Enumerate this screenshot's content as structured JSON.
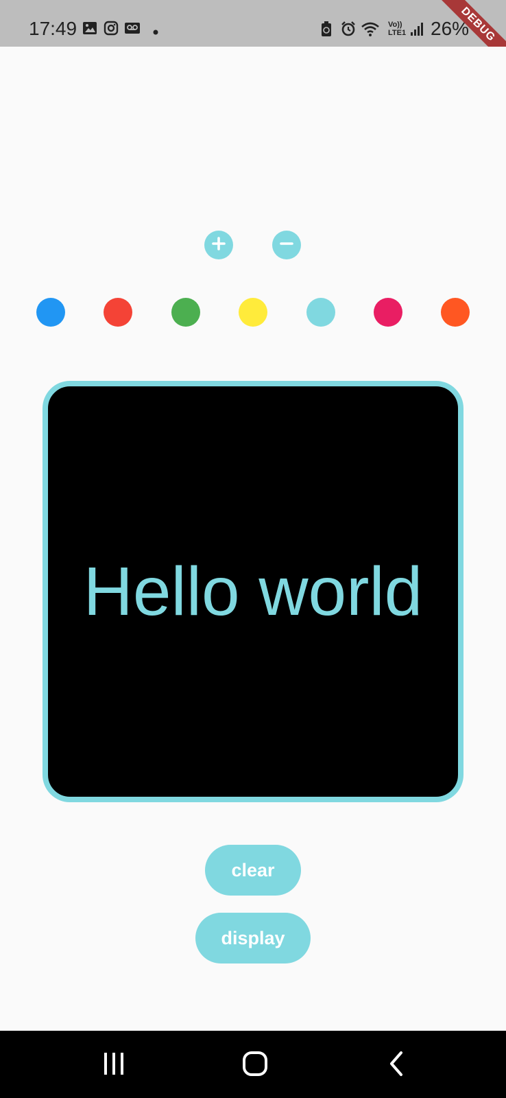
{
  "status_bar": {
    "time": "17:49",
    "icons_left": [
      "gallery-icon",
      "instagram-icon",
      "voicemail-icon",
      "dot-icon"
    ],
    "icons_right": [
      "battery-saver-icon",
      "alarm-icon",
      "wifi-icon",
      "volte-icon",
      "signal-icon"
    ],
    "volte_label": "Vo)) LTE1",
    "battery": "26%",
    "debug_banner": "DEBUG"
  },
  "size_controls": {
    "increase_icon": "plus-icon",
    "decrease_icon": "minus-icon"
  },
  "color_palette": [
    {
      "name": "blue",
      "color": "#2196f3"
    },
    {
      "name": "red",
      "color": "#f44336"
    },
    {
      "name": "green",
      "color": "#4caf50"
    },
    {
      "name": "yellow",
      "color": "#ffeb3b"
    },
    {
      "name": "cyan",
      "color": "#80d8e0"
    },
    {
      "name": "pink",
      "color": "#e91e63"
    },
    {
      "name": "orange",
      "color": "#ff5722"
    }
  ],
  "preview": {
    "text": "Hello world",
    "text_color": "#80d8e0",
    "background": "#000000",
    "border_color": "#80d8e0"
  },
  "actions": {
    "clear_label": "clear",
    "display_label": "display"
  },
  "nav_bar": {
    "items": [
      "recents-icon",
      "home-icon",
      "back-icon"
    ]
  },
  "theme": {
    "accent": "#80d8e0",
    "background": "#fafafa"
  }
}
